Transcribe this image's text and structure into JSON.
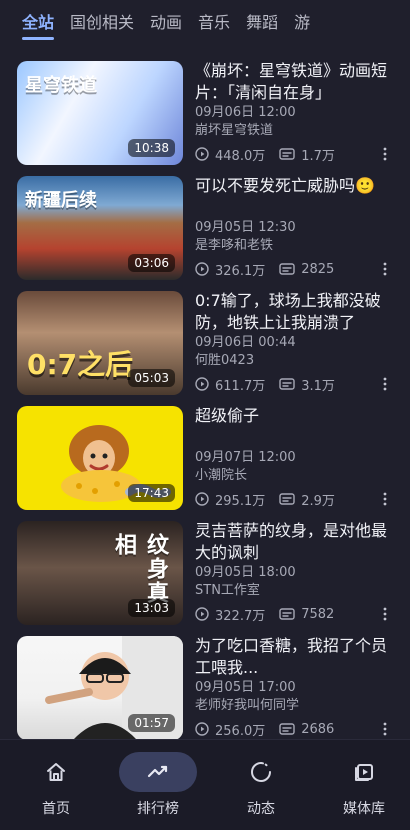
{
  "tabs": [
    {
      "label": "全站",
      "active": true
    },
    {
      "label": "国创相关",
      "active": false
    },
    {
      "label": "动画",
      "active": false
    },
    {
      "label": "音乐",
      "active": false
    },
    {
      "label": "舞蹈",
      "active": false
    },
    {
      "label": "游",
      "active": false
    }
  ],
  "list": [
    {
      "title": "《崩坏：星穹铁道》动画短片：「清闲自在身」",
      "time": "09月06日 12:00",
      "channel": "崩坏星穹铁道",
      "views": "448.0万",
      "comments": "1.7万",
      "duration": "10:38",
      "thumb_text": "星穹铁道"
    },
    {
      "title": "可以不要发死亡威胁吗🙂",
      "time": "09月05日 12:30",
      "channel": "是李哆和老铁",
      "views": "326.1万",
      "comments": "2825",
      "duration": "03:06",
      "thumb_text": "新疆后续"
    },
    {
      "title": "0:7输了，球场上我都没破防，地铁上让我崩溃了",
      "time": "09月06日 00:44",
      "channel": "何胜0423",
      "views": "611.7万",
      "comments": "3.1万",
      "duration": "05:03",
      "thumb_text": "0:7之后"
    },
    {
      "title": "超级偷子",
      "time": "09月07日 12:00",
      "channel": "小潮院长",
      "views": "295.1万",
      "comments": "2.9万",
      "duration": "17:43",
      "thumb_text": ""
    },
    {
      "title": "灵吉菩萨的纹身，是对他最大的讽刺",
      "time": "09月05日 18:00",
      "channel": "STN工作室",
      "views": "322.7万",
      "comments": "7582",
      "duration": "13:03",
      "thumb_text": "纹身真相"
    },
    {
      "title": "为了吃口香糖，我招了个员工喂我...",
      "time": "09月05日 17:00",
      "channel": "老师好我叫何同学",
      "views": "256.0万",
      "comments": "2686",
      "duration": "01:57",
      "thumb_text": ""
    }
  ],
  "bottom_nav": [
    {
      "label": "首页",
      "icon": "home-icon",
      "active": false
    },
    {
      "label": "排行榜",
      "icon": "trending-icon",
      "active": true
    },
    {
      "label": "动态",
      "icon": "activity-icon",
      "active": false
    },
    {
      "label": "媒体库",
      "icon": "library-icon",
      "active": false
    }
  ]
}
